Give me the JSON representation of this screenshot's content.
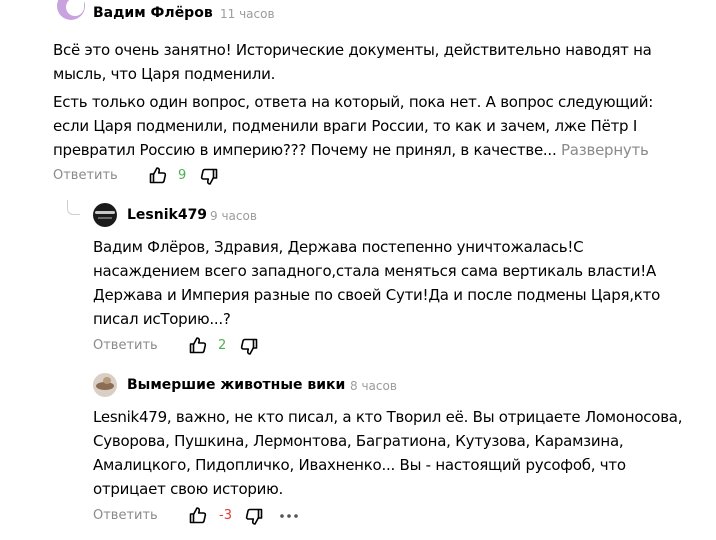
{
  "comments": [
    {
      "author": "Вадим Флёров",
      "time": "11 часов",
      "paragraphs": [
        [
          "Всё это очень занятно! Исторические документы, действительно наводят на",
          "мысль, что Царя подменили."
        ],
        [
          "Есть только один вопрос, ответа на который, пока нет. А вопрос следующий:",
          "если Царя подменили, подменили враги России, то как и зачем, лже Пётр I",
          "превратил Россию в империю??? Почему не принял, в качестве..."
        ]
      ],
      "expand_label": "Развернуть",
      "reply_label": "Ответить",
      "votes": "9",
      "votes_color": "#4caf50"
    },
    {
      "author": "Lesnik479",
      "time": "9 часов",
      "paragraphs": [
        [
          "Вадим Флёров, Здравия, Держава постепенно уничтожалась!С",
          "насаждением всего западного,стала меняться сама вертикаль власти!А",
          "Держава и Империя разные по своей Сути!Да и после подмены Царя,кто",
          "писал исТорию...?"
        ]
      ],
      "reply_label": "Ответить",
      "votes": "2",
      "votes_color": "#4caf50"
    },
    {
      "author": "Вымершие животные вики",
      "time": "8 часов",
      "paragraphs": [
        [
          "Lesnik479, важно, не кто писал, а кто Творил её. Вы отрицаете Ломоносова,",
          "Суворова, Пушкина, Лермонтова, Багратиона, Кутузова, Карамзина,",
          "Амалицкого, Пидопличко, Ивахненко... Вы - настоящий русофоб, что",
          "отрицает свою историю."
        ]
      ],
      "reply_label": "Ответить",
      "votes": "-3",
      "votes_color": "#e53935",
      "more_icon": "more-horizontal-icon"
    }
  ],
  "colors": {
    "text": "#000000",
    "muted": "#8a8a8a",
    "positive": "#4caf50",
    "negative": "#e53935",
    "avatar_purple": "#c9a2e0"
  },
  "icons": [
    "thumbs-up-icon",
    "thumbs-down-icon",
    "more-horizontal-icon"
  ]
}
